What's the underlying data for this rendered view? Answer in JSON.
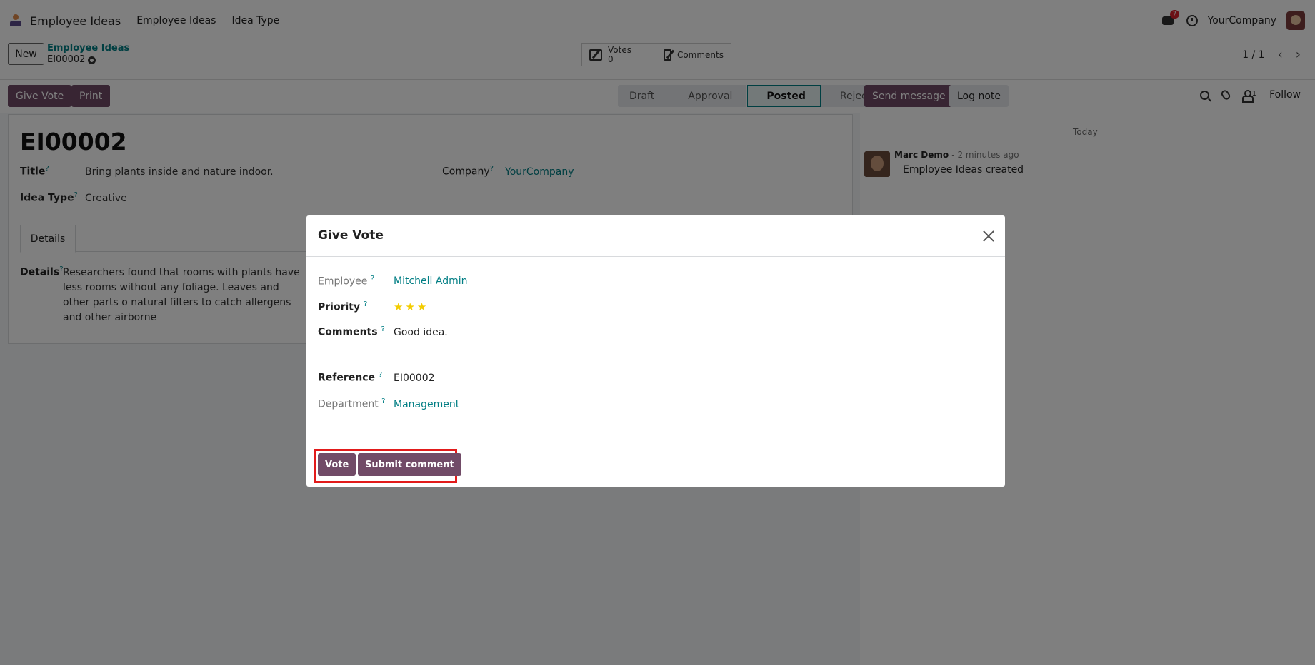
{
  "navbar": {
    "app_name": "Employee Ideas",
    "menu": [
      "Employee Ideas",
      "Idea Type"
    ],
    "message_count": "7",
    "company": "YourCompany"
  },
  "control": {
    "new_label": "New",
    "breadcrumb_parent": "Employee Ideas",
    "breadcrumb_current": "EI00002",
    "votes_label": "Votes",
    "votes_count": "0",
    "comments_label": "Comments",
    "pager": "1 / 1"
  },
  "actions": {
    "give_vote": "Give Vote",
    "print": "Print",
    "stages": [
      "Draft",
      "Approval",
      "Posted",
      "Rejected"
    ],
    "active_stage": "Posted",
    "send_message": "Send message",
    "log_note": "Log note",
    "follower_count": "1",
    "follow": "Follow"
  },
  "form": {
    "reference": "EI00002",
    "title_label": "Title",
    "title_value": "Bring plants inside and nature indoor.",
    "company_label": "Company",
    "company_value": "YourCompany",
    "idea_type_label": "Idea Type",
    "idea_type_value": "Creative",
    "tab_details": "Details",
    "details_label": "Details",
    "details_text": "Researchers found that rooms with plants have less rooms without any foliage. Leaves and other parts o natural filters to catch allergens and other airborne"
  },
  "chatter": {
    "date_separator": "Today",
    "author": "Marc Demo",
    "time": "- 2 minutes ago",
    "body": "Employee Ideas created"
  },
  "modal": {
    "title": "Give Vote",
    "employee_label": "Employee",
    "employee_value": "Mitchell Admin",
    "priority_label": "Priority",
    "priority_stars": 3,
    "comments_label": "Comments",
    "comments_value": "Good idea.",
    "reference_label": "Reference",
    "reference_value": "EI00002",
    "department_label": "Department",
    "department_value": "Management",
    "vote_button": "Vote",
    "submit_button": "Submit comment"
  },
  "colors": {
    "primary": "#714b67",
    "link": "#017e84",
    "highlight": "#e21b1b",
    "star": "#f3cc00"
  }
}
